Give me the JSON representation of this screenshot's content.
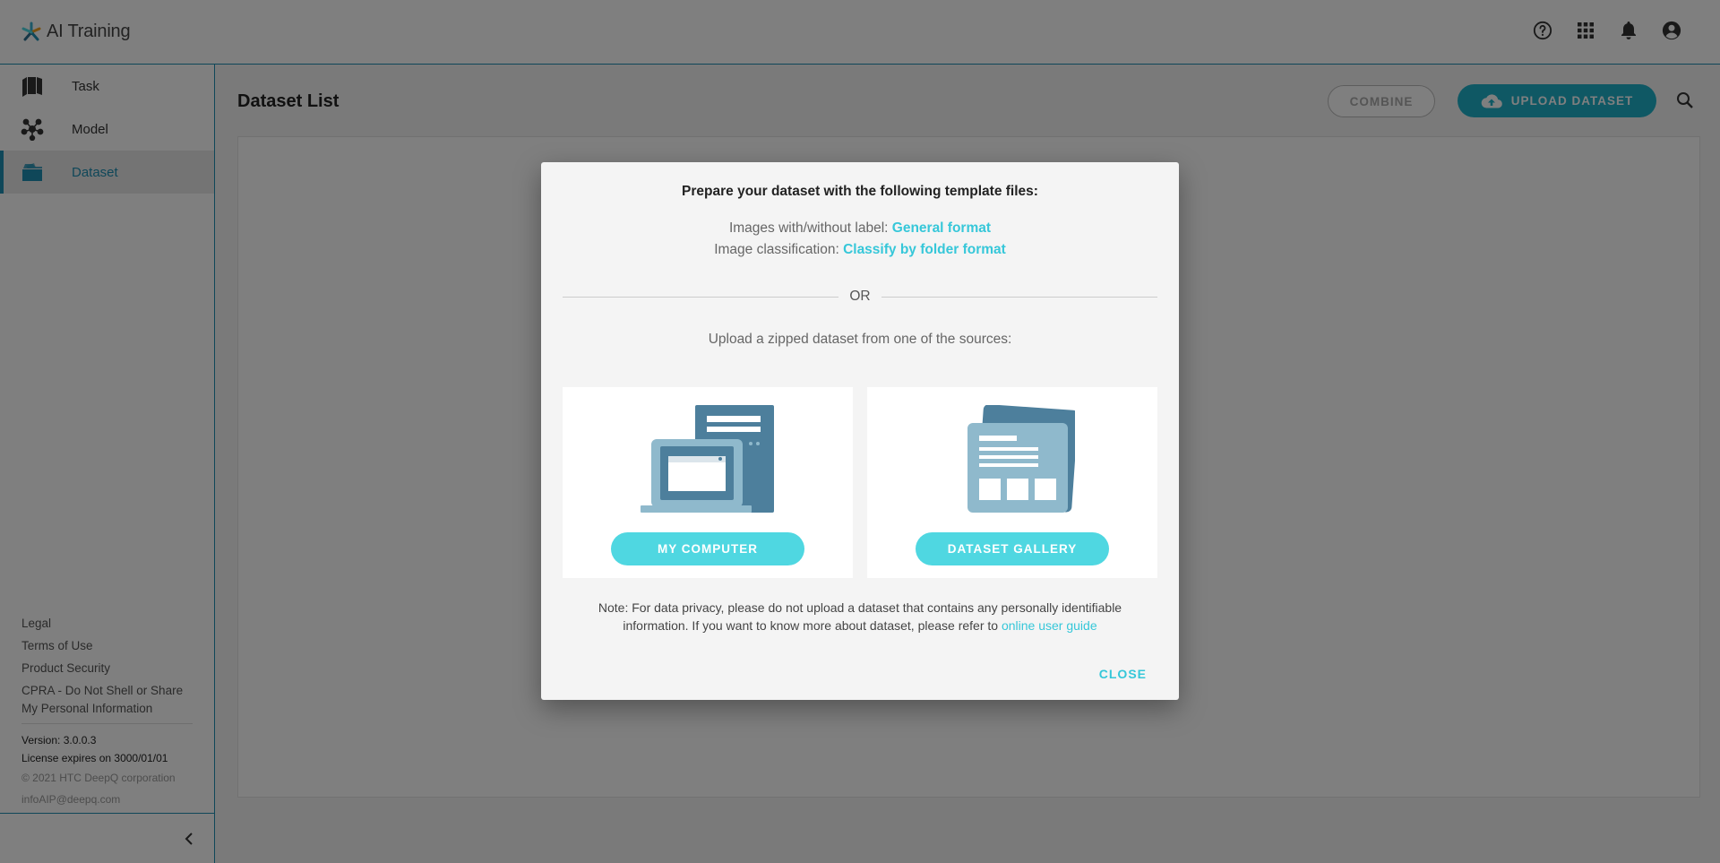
{
  "app": {
    "title": "AI Training",
    "top_icons": [
      "help-icon",
      "apps-grid-icon",
      "bell-icon",
      "account-icon"
    ]
  },
  "sidebar": {
    "items": [
      {
        "label": "Task",
        "icon": "book-icon",
        "active": false
      },
      {
        "label": "Model",
        "icon": "network-icon",
        "active": false
      },
      {
        "label": "Dataset",
        "icon": "folder-icon",
        "active": true
      }
    ],
    "footer_links": [
      "Legal",
      "Terms of Use",
      "Product Security",
      "CPRA - Do Not Shell or Share My Personal Information"
    ],
    "version": "Version: 3.0.0.3",
    "license": "License expires on 3000/01/01",
    "copyright": "© 2021 HTC DeepQ corporation",
    "email": "infoAIP@deepq.com"
  },
  "main": {
    "title": "Dataset List",
    "combine_label": "COMBINE",
    "upload_label": "UPLOAD DATASET"
  },
  "dialog": {
    "heading": "Prepare your dataset with the following template files:",
    "line1_prefix": "Images with/without label: ",
    "line1_link": "General format",
    "line2_prefix": "Image classification: ",
    "line2_link": "Classify by folder format",
    "or_text": "OR",
    "upload_text": "Upload a zipped dataset from one of the sources:",
    "card_computer_label": "MY COMPUTER",
    "card_gallery_label": "DATASET GALLERY",
    "note_text": "Note: For data privacy, please do not upload a dataset that contains any personally identifiable information. If you want to know more about dataset, please refer to ",
    "note_link": "online user guide",
    "close_label": "CLOSE"
  },
  "colors": {
    "accent": "#1f8fb3",
    "button_teal": "#4fd7e1",
    "link": "#36c7d9",
    "illustration_dark": "#4d7f9c",
    "illustration_light": "#8fb9cc"
  }
}
